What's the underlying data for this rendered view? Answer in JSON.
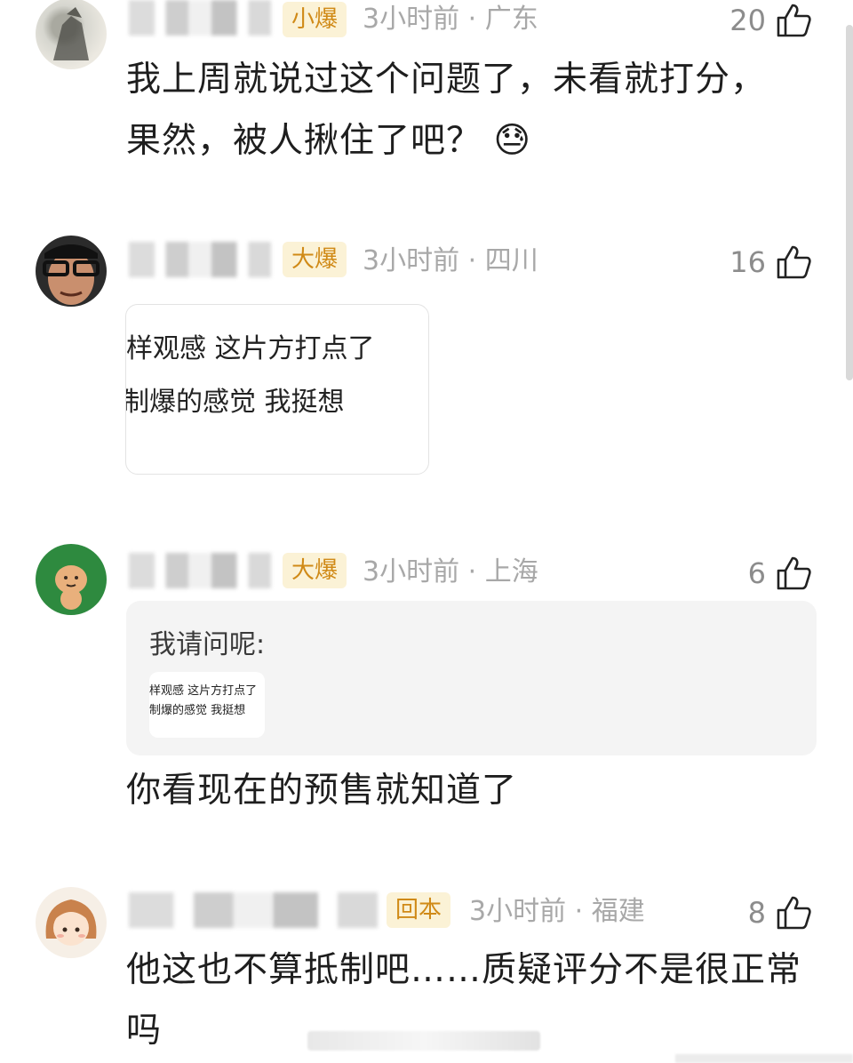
{
  "comments": [
    {
      "badge": "小爆",
      "meta": "3小时前 · 广东",
      "likes": "20",
      "text_lines": [
        "我上周就说过这个问题了，未看就打分，",
        "果然，被人揪住了吧？"
      ],
      "emoji": "😓"
    },
    {
      "badge": "大爆",
      "meta": "3小时前 · 四川",
      "likes": "16",
      "image_lines": [
        "样观感 这片方打点了",
        "制爆的感觉  我挺想"
      ]
    },
    {
      "badge": "大爆",
      "meta": "3小时前 · 上海",
      "likes": "6",
      "quote_text": "我请问呢:",
      "quote_image_lines": [
        "样观感  这片方打点了",
        "制爆的感觉  我挺想"
      ],
      "text_lines": [
        "你看现在的预售就知道了"
      ]
    },
    {
      "badge": "回本",
      "meta": "3小时前 · 福建",
      "likes": "8",
      "text_lines": [
        "他这也不算抵制吧……质疑评分不是很正常",
        "吗"
      ]
    }
  ],
  "colors": {
    "badge_bg": "#fbf2d6",
    "badge_text": "#d08a17",
    "meta_text": "#a8a8a8",
    "quote_bg": "#f4f4f4"
  },
  "icons": {
    "like": "thumb-up-outline-icon",
    "emoji": "sweat-face-icon"
  }
}
